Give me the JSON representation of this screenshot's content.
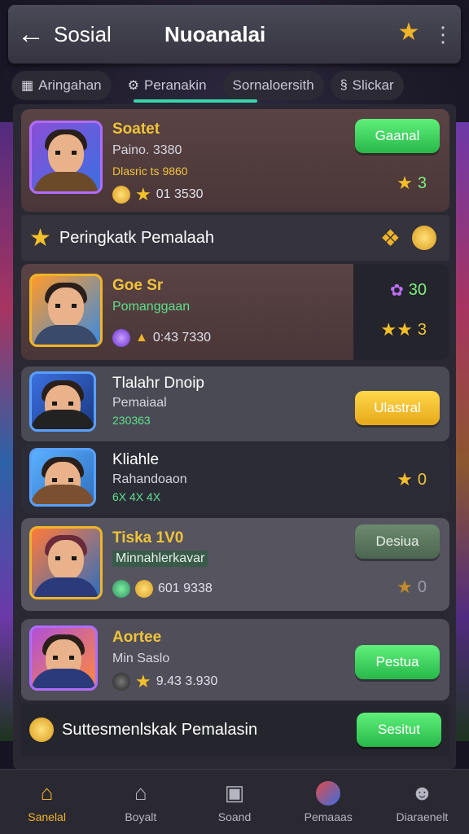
{
  "header": {
    "back_icon": "arrow-left-icon",
    "section": "Sosial",
    "title": "Nuoanalai",
    "trophy_icon": "trophy-icon",
    "more_icon": "more-vertical-icon"
  },
  "tabs": [
    {
      "label": "Aringahan",
      "icon": "grid-icon"
    },
    {
      "label": "Peranakin",
      "icon": "controller-icon",
      "active": true
    },
    {
      "label": "Sornaloersith"
    },
    {
      "label": "Slickar",
      "icon": "s-icon"
    }
  ],
  "players": [
    {
      "name": "Soatet",
      "line2": "Paino. 3380",
      "line3": "Dlasric ts 9860",
      "meta": "01 3530",
      "action": "Gaanal",
      "score": "3"
    },
    {
      "name": "Goe Sr",
      "line2": "Pomanggaan",
      "meta": "0:43 7330",
      "score_top": "30",
      "score": "3"
    },
    {
      "name": "Tlalahr Dnoip",
      "line2": "Pemaiaal",
      "line3": "230363",
      "action": "Ulastral"
    },
    {
      "name": "Kliahle",
      "line2": "Rahandoaon",
      "line3": "6X 4X 4X",
      "score": "0"
    },
    {
      "name": "Tiska 1V0",
      "line2": "Minnahlerkavar",
      "meta": "601 9338",
      "action": "Desiua",
      "score": "0"
    },
    {
      "name": "Aortee",
      "line2": "Min Saslo",
      "meta": "9.43 3.930",
      "action": "Pestua"
    }
  ],
  "sections": {
    "ranking": "Peringkatk Pemalaah",
    "footer": "Suttesmenlskak Pemalasin",
    "footer_action": "Sesitut"
  },
  "nav": [
    {
      "label": "Sanelal",
      "icon": "home-icon",
      "active": true
    },
    {
      "label": "Boyalt",
      "icon": "house-icon"
    },
    {
      "label": "Soand",
      "icon": "card-icon"
    },
    {
      "label": "Pemaaas",
      "icon": "avatar-icon"
    },
    {
      "label": "Diaraenelt",
      "icon": "smiley-icon"
    }
  ],
  "colors": {
    "accent": "#37d6a8",
    "gold": "#f0b429",
    "green": "#28b84a"
  }
}
